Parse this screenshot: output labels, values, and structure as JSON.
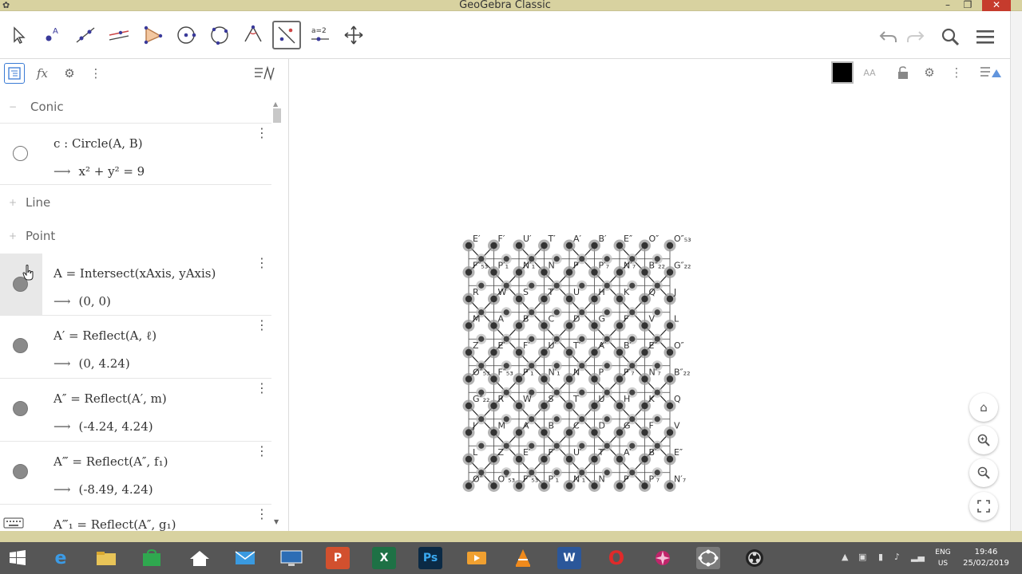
{
  "window": {
    "title": "GeoGebra Classic",
    "minimize": "–",
    "restore": "❐",
    "close": "✕"
  },
  "toolbar": {
    "tools": [
      {
        "name": "move-tool",
        "icon": "arrow-cursor-icon"
      },
      {
        "name": "point-tool",
        "icon": "point-icon",
        "label": "A"
      },
      {
        "name": "line-tool",
        "icon": "line-icon"
      },
      {
        "name": "perpendicular-line-tool",
        "icon": "parallel-lines-icon"
      },
      {
        "name": "polygon-tool",
        "icon": "triangle-icon"
      },
      {
        "name": "circle-center-point-tool",
        "icon": "circle-center-icon"
      },
      {
        "name": "circle-through-points-tool",
        "icon": "circle-points-icon"
      },
      {
        "name": "angle-tool",
        "icon": "angle-icon"
      },
      {
        "name": "reflect-about-line-tool",
        "icon": "reflect-line-icon",
        "selected": true
      },
      {
        "name": "slider-tool",
        "icon": "slider-icon",
        "label": "a=2"
      },
      {
        "name": "move-graphics-view-tool",
        "icon": "move-arrows-icon"
      }
    ],
    "right": [
      "undo-icon",
      "redo-icon",
      "search-icon",
      "menu-icon"
    ]
  },
  "algebra": {
    "header_icons": [
      "tree-view-icon",
      "fx-icon",
      "gear-icon",
      "more-vertical-icon",
      "sort-icon"
    ],
    "fx_label": "fx",
    "groups": {
      "conic": "Conic",
      "line": "Line",
      "point": "Point"
    },
    "items": [
      {
        "def": "c : Circle(A, B)",
        "out": "x² + y² = 9",
        "visible": false
      },
      {
        "def": "A = Intersect(xAxis, yAxis)",
        "out": "(0, 0)",
        "visible": true,
        "selected": true
      },
      {
        "def": "A′ = Reflect(A, ℓ)",
        "out": "(0, 4.24)",
        "visible": true
      },
      {
        "def": "A″ = Reflect(A′, m)",
        "out": "(-4.24, 4.24)",
        "visible": true
      },
      {
        "def": "A‴ = Reflect(A″, f₁)",
        "out": "(-8.49, 4.24)",
        "visible": true
      },
      {
        "def": "A‴₁ = Reflect(A″, g₁)",
        "out": "",
        "visible": true
      }
    ],
    "arrow": "⟶",
    "collapse_sign": "−",
    "expand_sign": "+"
  },
  "graphics": {
    "style_icons": [
      "color-swatch",
      "text-style-icon",
      "lock-icon",
      "gear-icon",
      "more-vertical-icon",
      "style-bar-toggle-icon"
    ],
    "text_style_label": "AA",
    "nav": [
      "home-icon",
      "zoom-in-icon",
      "zoom-out-icon",
      "fullscreen-icon"
    ],
    "point_color": "#333333",
    "point_halo": "#9a9a9a",
    "point_labels": [
      "E′",
      "F′",
      "U′",
      "T′",
      "A′",
      "B′",
      "E″",
      "O″",
      "O″₅₃",
      "F″₅₃",
      "P′₁",
      "N′₁",
      "N",
      "P",
      "P′₇",
      "N′₇",
      "B″₂₂",
      "G″₂₂",
      "R",
      "W",
      "S",
      "T",
      "U",
      "H",
      "K",
      "Q",
      "J",
      "M",
      "A",
      "B",
      "C",
      "D",
      "G",
      "F",
      "V",
      "L",
      "Z"
    ]
  },
  "taskbar": {
    "apps": [
      {
        "name": "start-button",
        "icon": "windows-icon"
      },
      {
        "name": "internet-explorer",
        "icon": "ie-icon",
        "label": "e"
      },
      {
        "name": "file-explorer",
        "icon": "folder-icon"
      },
      {
        "name": "store",
        "icon": "store-icon"
      },
      {
        "name": "home",
        "icon": "home-icon"
      },
      {
        "name": "mail",
        "icon": "mail-icon"
      },
      {
        "name": "remote-desktop",
        "icon": "monitor-icon"
      },
      {
        "name": "powerpoint",
        "icon": "powerpoint-icon",
        "label": "P"
      },
      {
        "name": "excel",
        "icon": "excel-icon",
        "label": "X"
      },
      {
        "name": "photoshop",
        "icon": "photoshop-icon",
        "label": "Ps"
      },
      {
        "name": "media",
        "icon": "media-icon"
      },
      {
        "name": "vlc",
        "icon": "vlc-icon"
      },
      {
        "name": "word",
        "icon": "word-icon",
        "label": "W"
      },
      {
        "name": "opera",
        "icon": "opera-icon",
        "label": "O"
      },
      {
        "name": "app-star",
        "icon": "star-icon"
      },
      {
        "name": "geogebra",
        "icon": "geogebra-icon",
        "active": true
      },
      {
        "name": "obs",
        "icon": "obs-icon"
      }
    ],
    "lang_top": "ENG",
    "lang_bottom": "US",
    "time": "19:46",
    "date": "25/02/2019"
  },
  "colors": {
    "titlebar": "#d8d2a0",
    "taskbar": "#565656",
    "close": "#c63b2d",
    "selected_tool_border": "#6b6b6b"
  }
}
